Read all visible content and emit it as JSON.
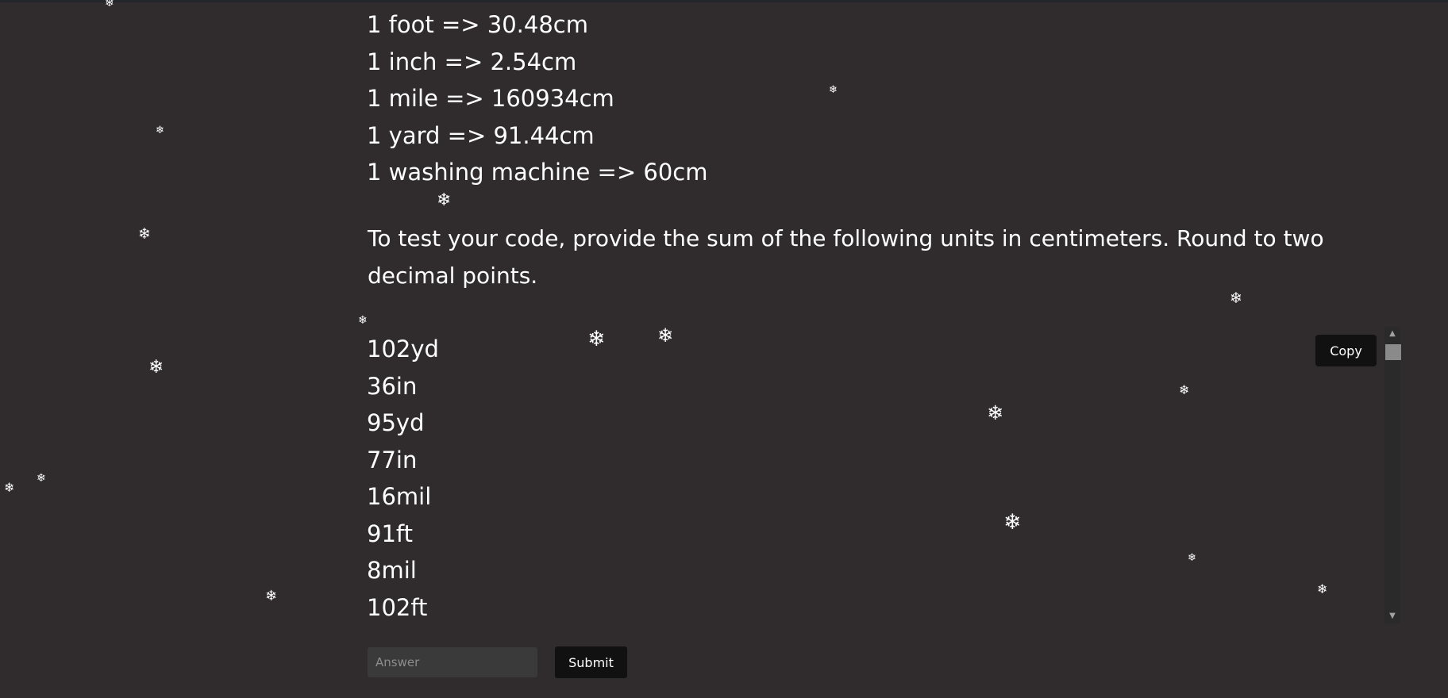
{
  "conversions": [
    "1 foot => 30.48cm",
    "1 inch => 2.54cm",
    "1 mile => 160934cm",
    "1 yard => 91.44cm",
    "1 washing machine => 60cm"
  ],
  "prompt": "To test your code, provide the sum of the following units in centimeters. Round to two decimal points.",
  "units": [
    "102yd",
    "36in",
    "95yd",
    "77in",
    "16mil",
    "91ft",
    "8mil",
    "102ft"
  ],
  "code_box": {
    "copy_label": "Copy",
    "scroll_up_icon": "scroll-up-arrow",
    "scroll_down_icon": "scroll-down-arrow"
  },
  "answer_form": {
    "placeholder": "Answer",
    "submit_label": "Submit"
  },
  "decor": {
    "snowflake_glyph": "❄",
    "snowflake_color": "#ffffff"
  },
  "colors": {
    "background": "#302c2d",
    "button": "#111111",
    "input": "#3a3a3a"
  }
}
